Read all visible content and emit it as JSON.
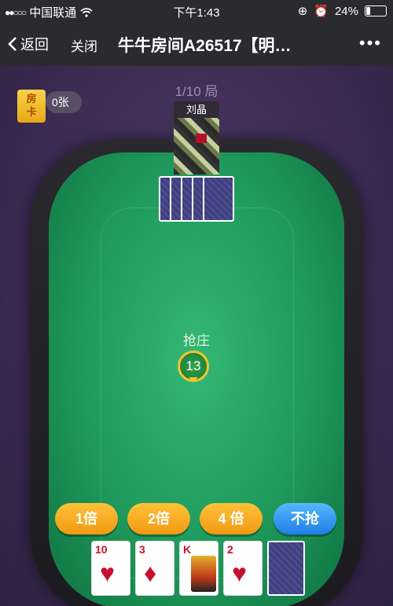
{
  "status": {
    "carrier": "中国联通",
    "time": "下午1:43",
    "battery": "24%",
    "battery_level": 0.24
  },
  "nav": {
    "back_label": "返回",
    "close_label": "关闭",
    "title": "牛牛房间A26517【明…",
    "more": "•••"
  },
  "game": {
    "round": "1/10 局",
    "room_card_label": "房卡",
    "card_count": "0张",
    "opponent_name": "刘晶",
    "grab_label": "抢庄",
    "timer": "13",
    "buttons": [
      "1倍",
      "2倍",
      "4 倍",
      "不抢"
    ],
    "hand": [
      {
        "rank": "10",
        "suit": "♥"
      },
      {
        "rank": "3",
        "suit": "♦"
      },
      {
        "rank": "K",
        "suit": "♦"
      },
      {
        "rank": "2",
        "suit": "♥"
      }
    ]
  }
}
